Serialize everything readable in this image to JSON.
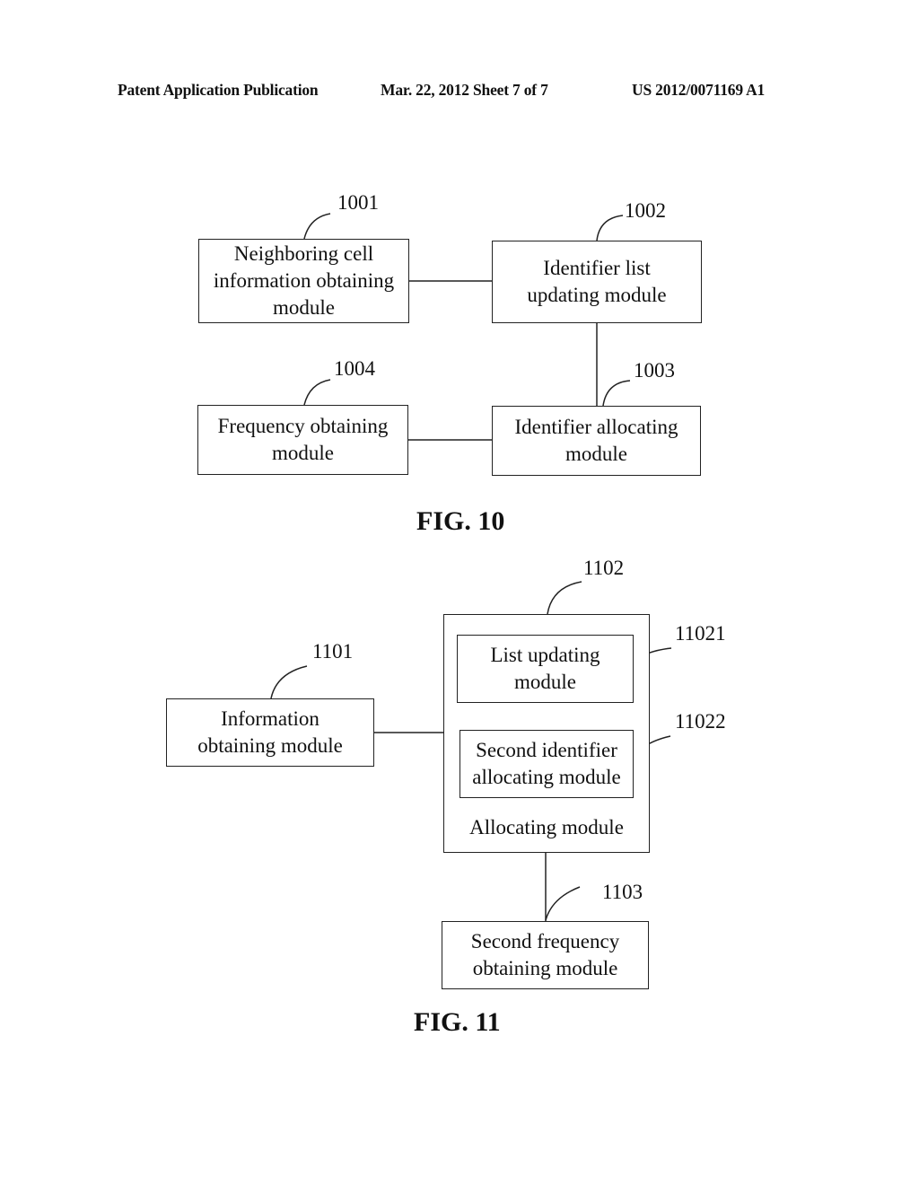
{
  "header": {
    "left": "Patent Application Publication",
    "center": "Mar. 22, 2012  Sheet 7 of 7",
    "right": "US 2012/0071169 A1"
  },
  "fig10": {
    "caption": "FIG. 10",
    "modules": [
      {
        "ref": "1001",
        "label": "Neighboring cell information obtaining module"
      },
      {
        "ref": "1002",
        "label": "Identifier list updating module"
      },
      {
        "ref": "1003",
        "label": "Identifier allocating module"
      },
      {
        "ref": "1004",
        "label": "Frequency obtaining module"
      }
    ],
    "connections": [
      [
        "1001",
        "1002"
      ],
      [
        "1002",
        "1003"
      ],
      [
        "1004",
        "1003"
      ]
    ]
  },
  "fig11": {
    "caption": "FIG. 11",
    "modules": [
      {
        "ref": "1101",
        "label": "Information obtaining module"
      },
      {
        "ref": "1102",
        "label": "Allocating module"
      },
      {
        "ref": "11021",
        "label": "List updating module"
      },
      {
        "ref": "11022",
        "label": "Second identifier allocating module"
      },
      {
        "ref": "1103",
        "label": "Second frequency obtaining module"
      }
    ],
    "connections": [
      [
        "1101",
        "1102"
      ],
      [
        "1102",
        "1103"
      ]
    ]
  }
}
